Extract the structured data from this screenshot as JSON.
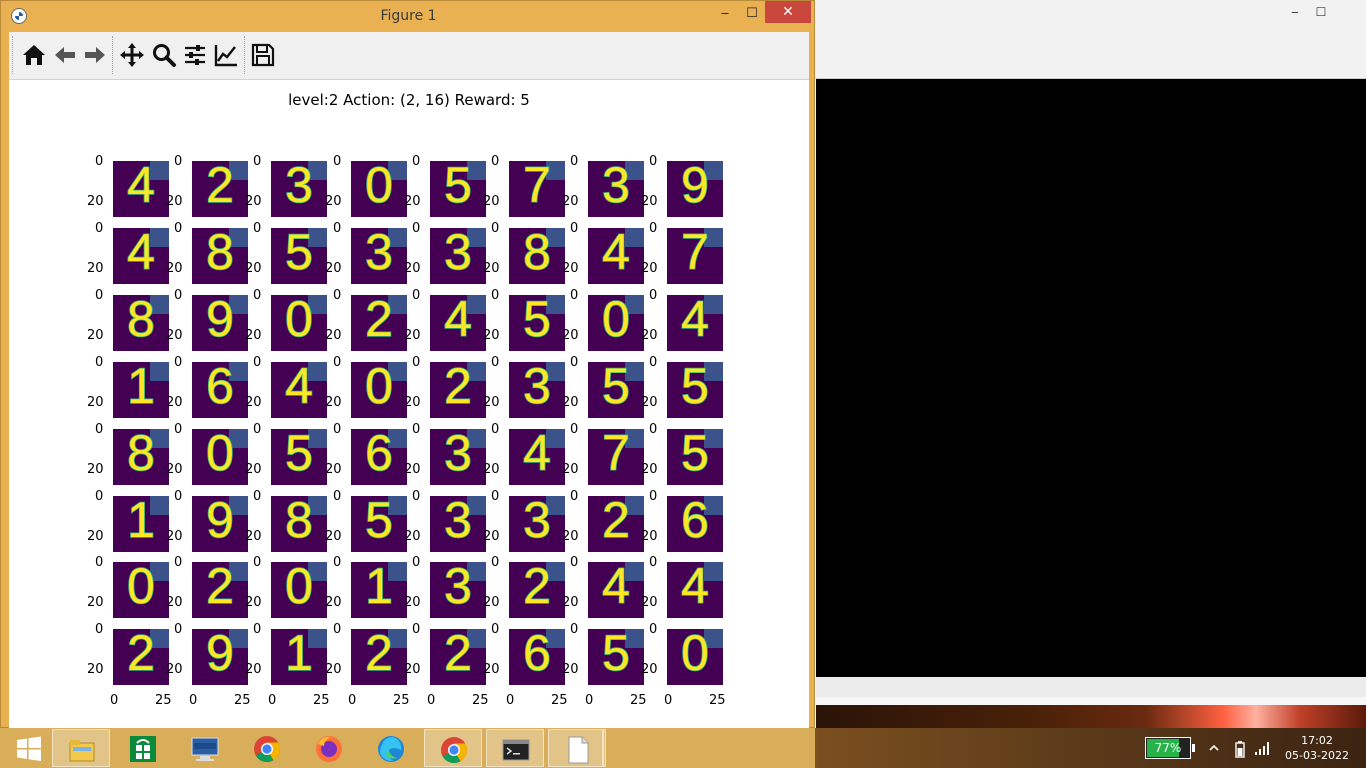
{
  "window": {
    "title": "Figure 1",
    "minimize_glyph": "‒",
    "maximize_glyph": "☐",
    "close_glyph": "✕"
  },
  "background_window": {
    "minimize_glyph": "‒",
    "maximize_glyph": "☐"
  },
  "toolbar": {
    "buttons": [
      "home-icon",
      "back-arrow-icon",
      "forward-arrow-icon",
      "pan-move-icon",
      "zoom-magnifier-icon",
      "subplots-sliders-icon",
      "edit-axes-chart-icon",
      "save-floppy-icon"
    ]
  },
  "figure": {
    "title": "level:2 Action: (2, 16) Reward: 5",
    "digits": [
      [
        "4",
        "2",
        "3",
        "0",
        "5",
        "7",
        "3",
        "9"
      ],
      [
        "4",
        "8",
        "5",
        "3",
        "3",
        "8",
        "4",
        "7"
      ],
      [
        "8",
        "9",
        "0",
        "2",
        "4",
        "5",
        "0",
        "4"
      ],
      [
        "1",
        "6",
        "4",
        "0",
        "2",
        "3",
        "5",
        "5"
      ],
      [
        "8",
        "0",
        "5",
        "6",
        "3",
        "4",
        "7",
        "5"
      ],
      [
        "1",
        "9",
        "8",
        "5",
        "3",
        "3",
        "2",
        "6"
      ],
      [
        "0",
        "2",
        "0",
        "1",
        "3",
        "2",
        "4",
        "4"
      ],
      [
        "2",
        "9",
        "1",
        "2",
        "2",
        "6",
        "5",
        "0"
      ]
    ],
    "y_ticks": [
      "0",
      "20"
    ],
    "x_ticks": [
      "0",
      "25"
    ],
    "colors": {
      "background": "#440154",
      "stroke": "#fde725",
      "edge": "#35b779",
      "patch": "#3b528b"
    }
  },
  "taskbar": {
    "items": [
      "windows-start-icon",
      "file-explorer-icon",
      "store-icon",
      "lenovo-icon",
      "chrome-icon",
      "firefox-icon",
      "edge-icon",
      "chrome-icon",
      "terminal-icon",
      "notepad-icon"
    ],
    "battery": {
      "percent_label": "77%",
      "level": 0.77
    },
    "time": "17:02",
    "date": "05-03-2022"
  }
}
